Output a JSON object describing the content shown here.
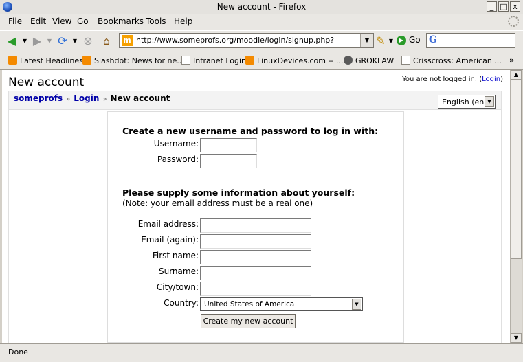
{
  "window": {
    "title": "New account - Firefox",
    "minimize": "_",
    "maximize": "□",
    "close": "x"
  },
  "menu": [
    "File",
    "Edit",
    "View",
    "Go",
    "Bookmarks",
    "Tools",
    "Help"
  ],
  "nav": {
    "url": "http://www.someprofs.org/moodle/login/signup.php?",
    "go_label": "Go",
    "favicon_letter": "m",
    "search_letter": "G"
  },
  "bookmarks": [
    "Latest Headlines",
    "Slashdot: News for ne...",
    "Intranet Login",
    "LinuxDevices.com -- ...",
    "GROKLAW",
    "Crisscross: American ...",
    "»"
  ],
  "page": {
    "heading": "New account",
    "login_status": "You are not logged in.",
    "login_link": "Login",
    "crumbs": [
      "someprofs",
      "Login",
      "New account"
    ],
    "crumb_sep": "»",
    "language": "English (en)",
    "section1_heading": "Create a new username and password to log in with:",
    "labels1": [
      "Username:",
      "Password:"
    ],
    "section2_heading": "Please supply some information about yourself:",
    "section2_note": "(Note: your email address must be a real one)",
    "labels2": [
      "Email address:",
      "Email (again):",
      "First name:",
      "Surname:",
      "City/town:",
      "Country:"
    ],
    "country_value": "United States of America",
    "submit_label": "Create my new account"
  },
  "status": "Done"
}
